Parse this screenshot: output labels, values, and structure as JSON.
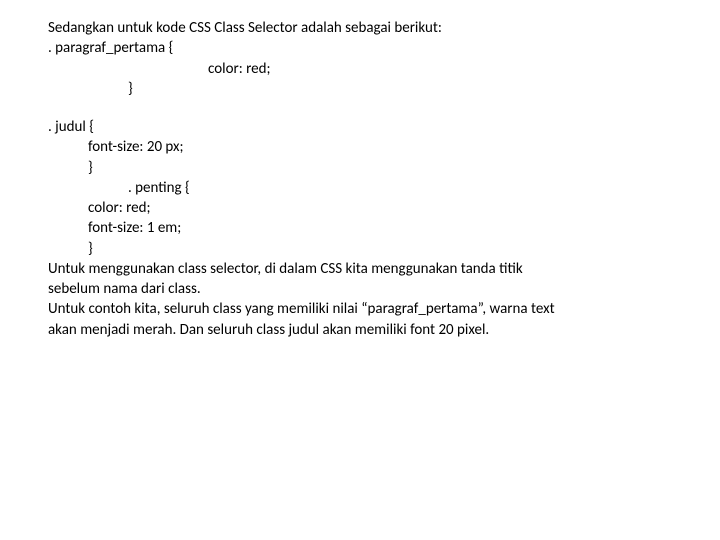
{
  "lines": {
    "l1": "Sedangkan untuk kode CSS Class Selector adalah sebagai berikut:",
    "l2": ". paragraf_pertama {",
    "l3": "color: red;",
    "l4": "}",
    "l5": ". judul {",
    "l6": "font-size: 20 px;",
    "l7": "}",
    "l8": ". penting {",
    "l9": "color: red;",
    "l10": "font-size: 1 em;",
    "l11": "}",
    "l12": "Untuk menggunakan class selector, di dalam CSS kita menggunakan tanda titik",
    "l13": "sebelum nama dari class.",
    "l14": "Untuk contoh kita, seluruh class yang memiliki nilai “paragraf_pertama”, warna text",
    "l15": "akan menjadi merah. Dan seluruh class judul akan memiliki font 20 pixel."
  }
}
